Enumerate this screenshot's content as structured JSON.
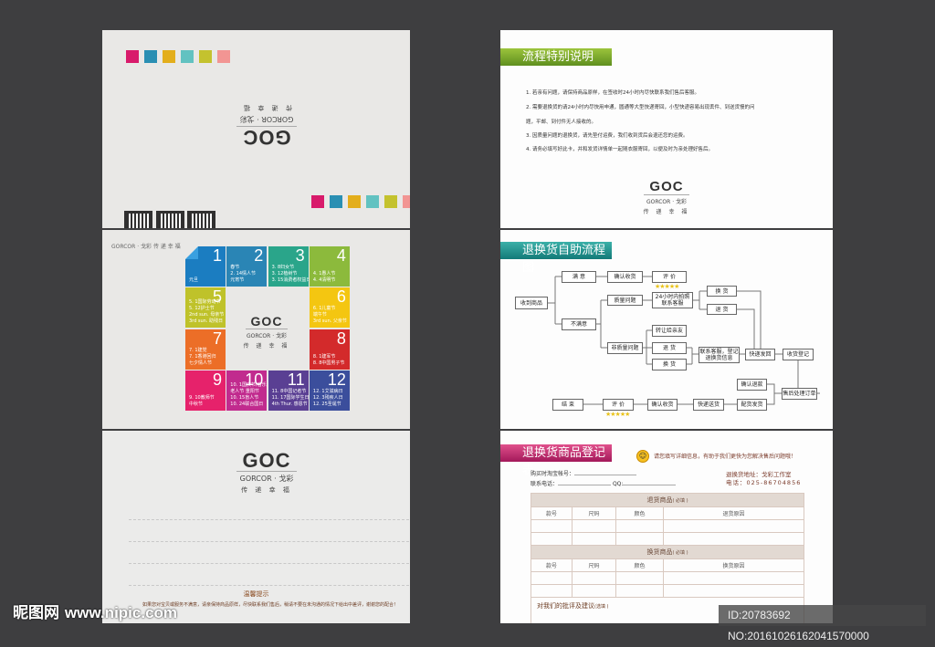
{
  "brand": {
    "logo": "GOC",
    "sub": "GORCOR · 戈彩",
    "tagline": "传 递 幸 福",
    "small": "GORCOR · 戈彩    传 递 幸 福"
  },
  "colors": {
    "swatches": [
      "#d81b6b",
      "#2a8fb3",
      "#e3ae1c",
      "#62c2c1",
      "#c4c22e",
      "#f29593"
    ],
    "bg": "#3e3e40"
  },
  "calendar": [
    {
      "num": "1",
      "color": "#1b7dc1",
      "lines": [
        "元旦"
      ]
    },
    {
      "num": "2",
      "color": "#2a85b5",
      "lines": [
        "春节",
        "2. 14情人节",
        "元宵节"
      ]
    },
    {
      "num": "3",
      "color": "#2aa58a",
      "lines": [
        "3. 8妇女节",
        "3. 12植树节",
        "3. 15消费者权益日"
      ]
    },
    {
      "num": "4",
      "color": "#8cba3c",
      "lines": [
        "4. 1愚人节",
        "4. 4清明节"
      ]
    },
    {
      "num": "5",
      "color": "#bfc22a",
      "lines": [
        "5. 1国际劳动节",
        "5. 12护士节",
        "2nd sun. 母亲节",
        "3rd sun. 助残日"
      ]
    },
    {
      "num": "6",
      "color": "#f4c611",
      "lines": [
        "6. 1儿童节",
        "端午节",
        "3rd sun. 父亲节"
      ]
    },
    {
      "num": "7",
      "color": "#ec6e27",
      "lines": [
        "7. 1建党",
        "7. 1香港回归",
        "七夕情人节"
      ]
    },
    {
      "num": "8",
      "color": "#d32a2b",
      "lines": [
        "8. 1建军节",
        "8. 8中国男子节"
      ]
    },
    {
      "num": "9",
      "color": "#e6226b",
      "lines": [
        "9. 10教师节",
        "中秋节"
      ]
    },
    {
      "num": "10",
      "color": "#c12b8e",
      "lines": [
        "10. 1国庆节/音乐日",
        "老人节  重阳节",
        "10. 15盲人节",
        "10. 24联合国日"
      ]
    },
    {
      "num": "11",
      "color": "#5a3f93",
      "lines": [
        "11. 8中国记者节",
        "11. 17国际学生日",
        "4th Thur. 感恩节"
      ]
    },
    {
      "num": "12",
      "color": "#3b4e9c",
      "lines": [
        "12. 1艾滋病日",
        "12. 3残疾人日",
        "12. 25圣诞节"
      ]
    }
  ],
  "back": {
    "tip_title": "温馨提示",
    "tip_text": "如果您对宝贝或服务不满意，请亲保持商品原样，尽快联系我们售后，稍请不要在未沟通的情况下给出中差评，谢谢您的配合！"
  },
  "rules": {
    "title": "流程特别说明",
    "items": [
      "1. 若亲有问题，请保持商品原样，在签收时24小时内尽快联系我们售后客服。",
      "2. 需要退换货的请24小时内尽快用申通，圆通等大型快递寄回，小型快递容易出现丢件、到送货慢的问",
      "题，平邮、到付件无人接收的。",
      "3. 因质量问题的退换货，请先垫付运费，我们收到货后会退还您的运费。",
      "4. 请务必填写好此卡，并和发货详情单一起随衣服寄回，以便及时为亲处理好售后。"
    ]
  },
  "flow": {
    "title": "退换货自助流程图",
    "nodes": {
      "receive": "收到商品",
      "satisfied": "满 意",
      "confirm1": "确认收货",
      "rate1": "评 价",
      "contact24": "24小时内拍照联系客服",
      "quality": "质量问题",
      "unsatisfied": "不满意",
      "exchange1": "换 货",
      "return1": "退 货",
      "transfer": "转让给亲友",
      "nonquality": "非质量问题",
      "return2": "退 货",
      "exchange2": "换 货",
      "register": "联系客服，登记退换货信息",
      "shipback": "快递发回",
      "receipt": "收货登记",
      "process": "售后处理订单",
      "refund": "确认退款",
      "dispatch": "配货发货",
      "deliver": "快递送货",
      "confirm2": "确认收货",
      "rate2": "评 价",
      "end": "结 束"
    },
    "stars": "★★★★★"
  },
  "form": {
    "title": "退换货商品登记表",
    "notice": "请您填写详细信息，有助于我们更快为您解决售后问题哦！",
    "account_label": "购买时淘宝帐号：",
    "phone_label": "联系电话：",
    "qq_label": "QQ:",
    "address": "退换货地址：戈彩工作室",
    "tel": "电话：025-86704856",
    "return_section": "退货商品",
    "exchange_section": "换货商品",
    "required": "( 必填 )",
    "cols_return": [
      "款号",
      "尺码",
      "颜色",
      "退货原因"
    ],
    "cols_exchange": [
      "款号",
      "尺码",
      "颜色",
      "换货原因"
    ],
    "suggest": "对我们的批评及建议",
    "optional": "(选填 )"
  },
  "watermark": {
    "site_cn": "昵图网",
    "site": "www.nipic.com",
    "id": "ID:20783692 NO:20161026162041570000"
  }
}
